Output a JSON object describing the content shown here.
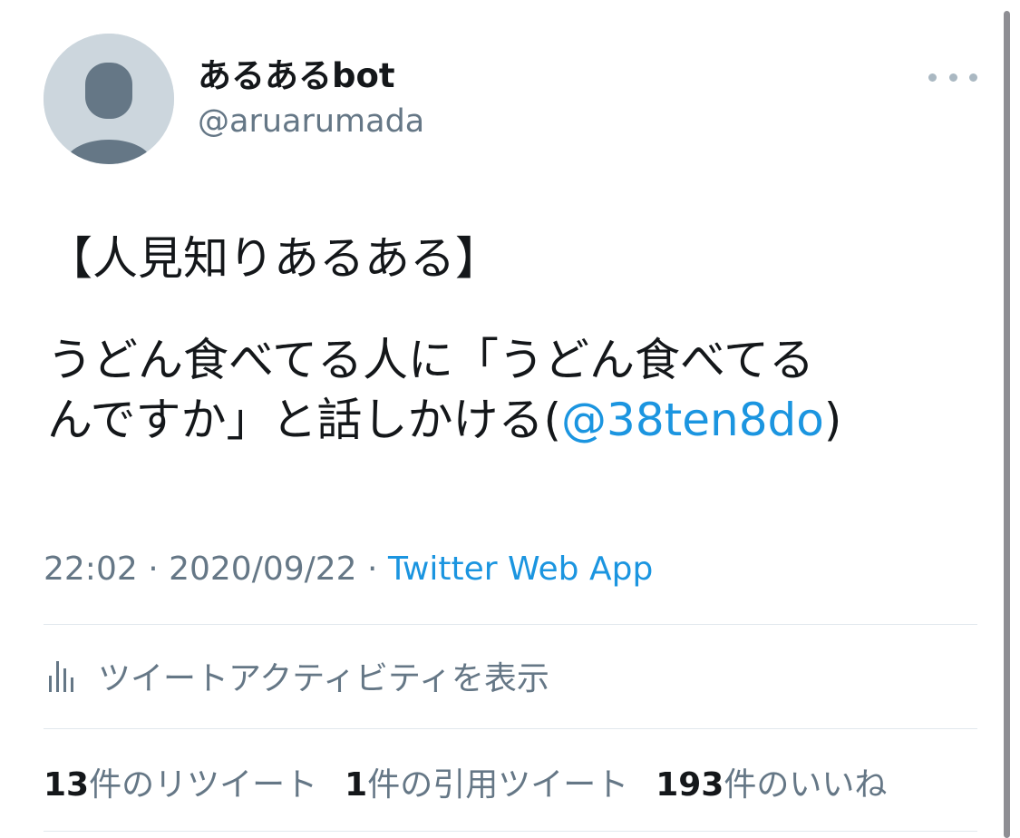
{
  "tweet": {
    "author": {
      "display_name": "あるあるbot",
      "handle": "@aruarumada"
    },
    "text": {
      "heading": "【人見知りあるある】",
      "body_line1": "うどん食べてる人に「うどん食べてる",
      "body_line2": "んですか」と話しかける(",
      "mention": "@38ten8do",
      "body_close": ")"
    },
    "time": "22:02",
    "date": "2020/09/22",
    "separator": " · ",
    "source": "Twitter Web App",
    "activity_label": "ツイートアクティビティを表示",
    "stats": {
      "retweets_count": "13",
      "retweets_label": "件のリツイート",
      "quotes_count": "1",
      "quotes_label": "件の引用ツイート",
      "likes_count": "193",
      "likes_label": "件のいいね"
    }
  },
  "icons": {
    "avatar": "default-profile-icon",
    "more": "more-icon",
    "activity": "analytics-icon"
  },
  "colors": {
    "link": "#1b95e0",
    "secondary_text": "#657786",
    "primary_text": "#14171a",
    "divider": "#e1e8ed",
    "avatar_bg": "#ccd6dd"
  }
}
